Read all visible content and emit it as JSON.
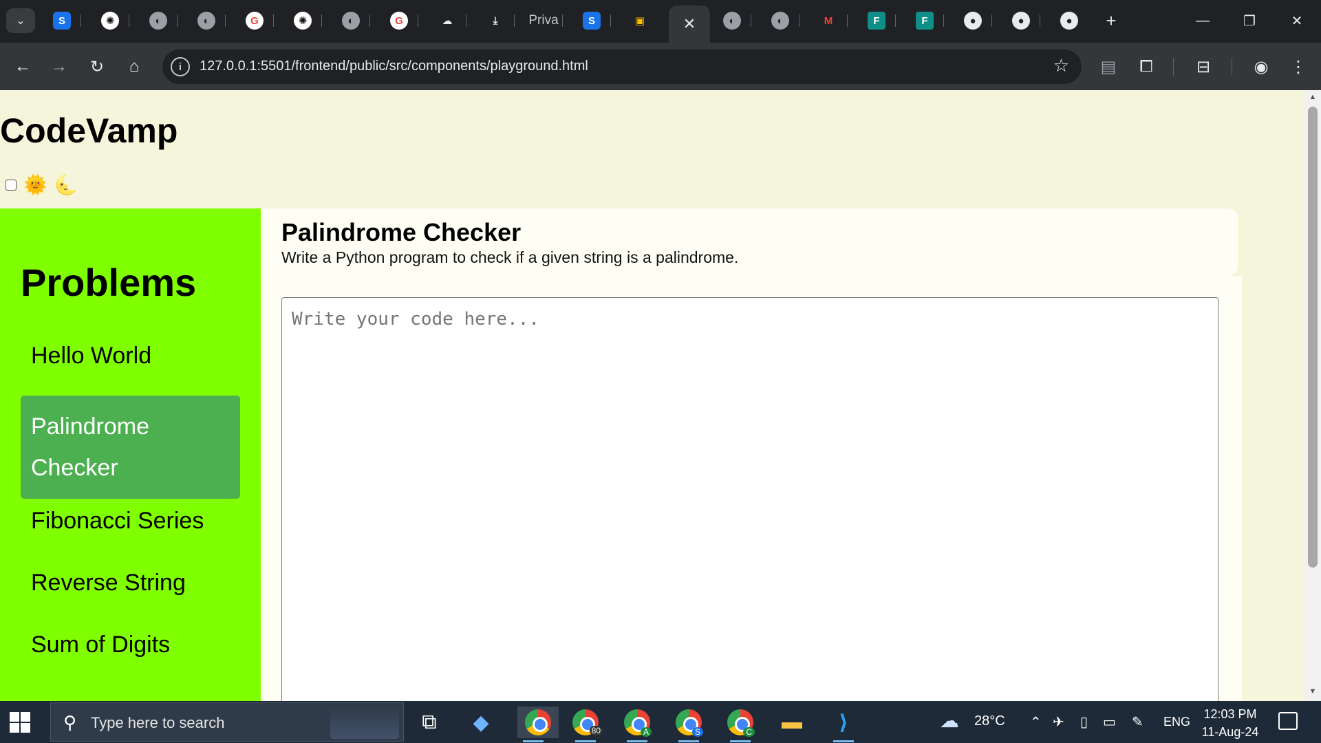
{
  "browser": {
    "tabs": [
      {
        "name": "tab-1",
        "icon": "s-app-icon",
        "glyph": "S"
      },
      {
        "name": "tab-2",
        "icon": "openai-icon",
        "glyph": "✺"
      },
      {
        "name": "tab-3",
        "icon": "globe-icon",
        "glyph": "◐"
      },
      {
        "name": "tab-4",
        "icon": "globe-icon",
        "glyph": "◐"
      },
      {
        "name": "tab-5",
        "icon": "google-icon",
        "glyph": "G"
      },
      {
        "name": "tab-6",
        "icon": "chatgpt-icon",
        "glyph": "✺"
      },
      {
        "name": "tab-7",
        "icon": "globe-icon",
        "glyph": "◐"
      },
      {
        "name": "tab-8",
        "icon": "google-icon",
        "glyph": "G"
      },
      {
        "name": "tab-9",
        "icon": "cloud-icon",
        "glyph": "☁"
      },
      {
        "name": "tab-10",
        "icon": "download-icon",
        "glyph": "⤓"
      },
      {
        "name": "tab-11",
        "text": "Priva"
      },
      {
        "name": "tab-12",
        "icon": "s-app-icon",
        "glyph": "S"
      },
      {
        "name": "tab-13",
        "icon": "document-icon",
        "glyph": "▣"
      },
      {
        "name": "tab-15",
        "icon": "globe-icon",
        "glyph": "◐"
      },
      {
        "name": "tab-16",
        "icon": "globe-icon",
        "glyph": "◐"
      },
      {
        "name": "tab-17",
        "icon": "gmail-icon",
        "glyph": "M"
      },
      {
        "name": "tab-18",
        "icon": "forms-icon",
        "glyph": "F"
      },
      {
        "name": "tab-19",
        "icon": "forms-icon",
        "glyph": "F"
      },
      {
        "name": "tab-20",
        "icon": "github-icon",
        "glyph": "●"
      },
      {
        "name": "tab-21",
        "icon": "github-icon",
        "glyph": "●"
      },
      {
        "name": "tab-22",
        "icon": "github-icon",
        "glyph": "●"
      }
    ],
    "active_tab_close": "✕",
    "url": "127.0.0.1:5501/frontend/public/src/components/playground.html"
  },
  "page": {
    "brand": "CodeVamp",
    "theme": {
      "sun": "🌞",
      "moon": "🌜"
    },
    "sidebar": {
      "title": "Problems",
      "items": [
        {
          "label": "Hello World",
          "active": false
        },
        {
          "label": "Palindrome Checker",
          "active": true
        },
        {
          "label": "Fibonacci Series",
          "active": false
        },
        {
          "label": "Reverse String",
          "active": false
        },
        {
          "label": "Sum of Digits",
          "active": false
        }
      ]
    },
    "problem": {
      "title": "Palindrome Checker",
      "description": "Write a Python program to check if a given string is a palindrome."
    },
    "editor": {
      "placeholder": "Write your code here...",
      "value": ""
    }
  },
  "taskbar": {
    "search_placeholder": "Type here to search",
    "apps": [
      {
        "name": "task-view-icon",
        "glyph": "⧉"
      },
      {
        "name": "copilot-icon",
        "glyph": "◆"
      },
      {
        "name": "chrome-icon"
      },
      {
        "name": "chrome-profile-icon"
      },
      {
        "name": "chrome-profile-a-icon"
      },
      {
        "name": "chrome-profile-s-icon"
      },
      {
        "name": "chrome-profile-c-icon"
      },
      {
        "name": "file-explorer-icon",
        "glyph": "▬"
      },
      {
        "name": "vscode-icon",
        "glyph": "⟩"
      }
    ],
    "badge_count": "80",
    "profile_letters": [
      "A",
      "S",
      "C"
    ],
    "weather": {
      "temp": "28°C"
    },
    "language": "ENG",
    "time": "12:03 PM",
    "date": "11-Aug-24"
  },
  "colors": {
    "page_bg": "#f5f5dc",
    "sidebar_bg": "#7fff00",
    "active_item_bg": "#4caf50",
    "card_bg": "#fefef4"
  }
}
